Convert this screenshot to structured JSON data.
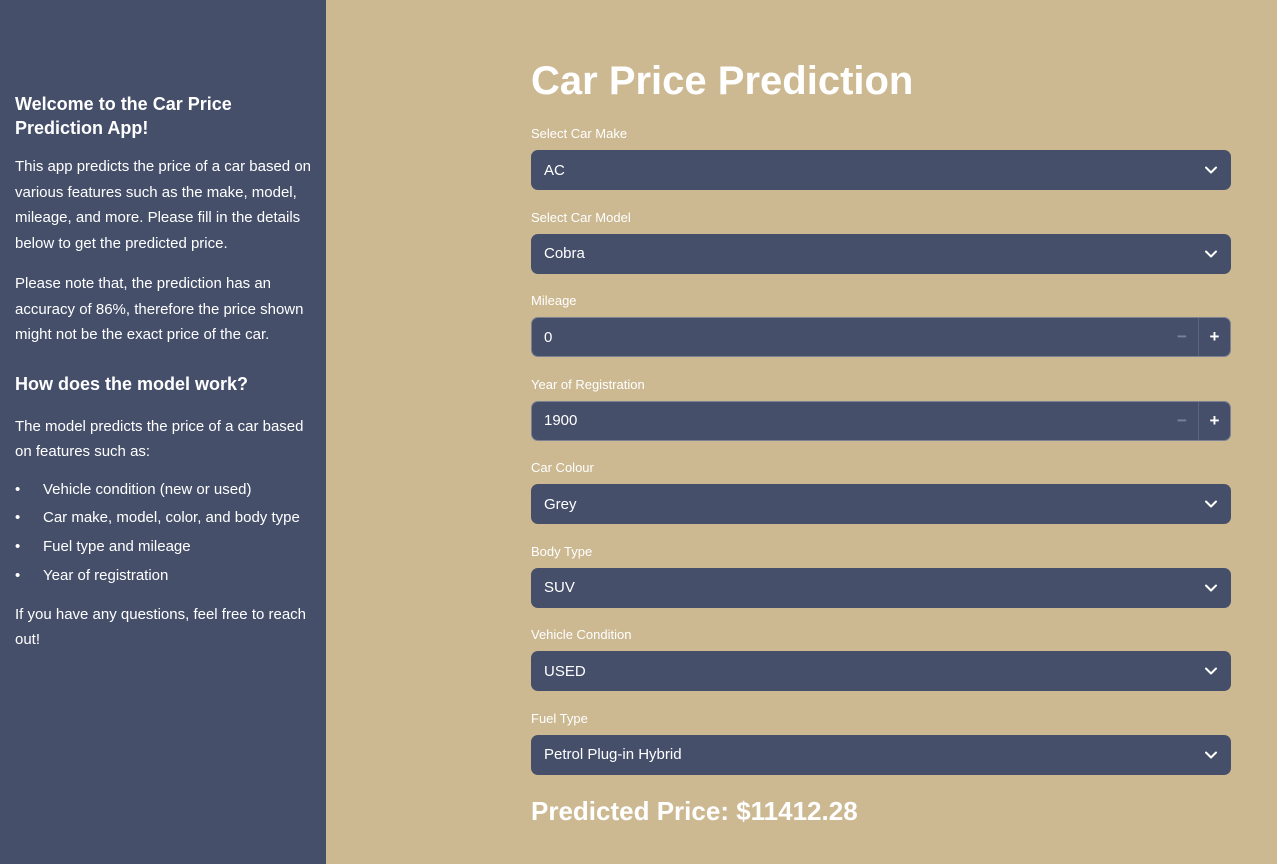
{
  "sidebar": {
    "welcome_title": "Welcome to the Car Price Prediction App!",
    "intro": "This app predicts the price of a car based on various features such as the make, model, mileage, and more. Please fill in the details below to get the predicted price.",
    "note": "Please note that, the prediction has an accuracy of 86%, therefore the price shown might not be the exact price of the car.",
    "how_title": "How does the model work?",
    "how_text": "The model predicts the price of a car based on features such as:",
    "features": [
      "Vehicle condition (new or used)",
      "Car make, model, color, and body type",
      "Fuel type and mileage",
      "Year of registration"
    ],
    "outro": "If you have any questions, feel free to reach out!"
  },
  "main": {
    "title": "Car Price Prediction",
    "make": {
      "label": "Select Car Make",
      "value": "AC"
    },
    "model": {
      "label": "Select Car Model",
      "value": "Cobra"
    },
    "mileage": {
      "label": "Mileage",
      "value": "0",
      "minus": "−",
      "plus": "+"
    },
    "year": {
      "label": "Year of Registration",
      "value": "1900",
      "minus": "−",
      "plus": "+"
    },
    "colour": {
      "label": "Car Colour",
      "value": "Grey"
    },
    "body": {
      "label": "Body Type",
      "value": "SUV"
    },
    "condition": {
      "label": "Vehicle Condition",
      "value": "USED"
    },
    "fuel": {
      "label": "Fuel Type",
      "value": "Petrol Plug-in Hybrid"
    },
    "prediction": "Predicted Price: $11412.28"
  },
  "colors": {
    "sidebar_bg": "#454f6a",
    "main_bg": "#ccb992",
    "input_bg": "#454f6a",
    "text": "#ffffff"
  },
  "icons": {
    "dropdown": "chevron-down-icon",
    "decrement": "minus-icon",
    "increment": "plus-icon"
  }
}
